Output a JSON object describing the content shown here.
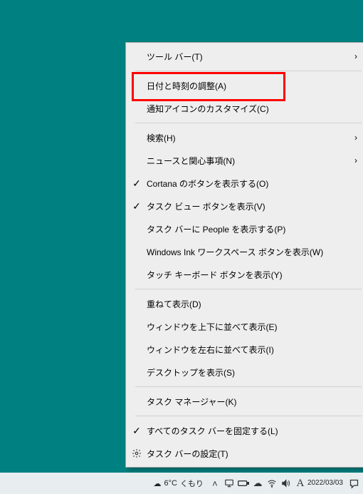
{
  "menu": {
    "groups": [
      [
        {
          "label": "ツール バー(T)",
          "checked": false,
          "submenu": true,
          "icon": null
        }
      ],
      [
        {
          "label": "日付と時刻の調整(A)",
          "checked": false,
          "submenu": false,
          "icon": null,
          "highlighted": true
        },
        {
          "label": "通知アイコンのカスタマイズ(C)",
          "checked": false,
          "submenu": false,
          "icon": null
        }
      ],
      [
        {
          "label": "検索(H)",
          "checked": false,
          "submenu": true,
          "icon": null
        },
        {
          "label": "ニュースと関心事項(N)",
          "checked": false,
          "submenu": true,
          "icon": null
        },
        {
          "label": "Cortana のボタンを表示する(O)",
          "checked": true,
          "submenu": false,
          "icon": null
        },
        {
          "label": "タスク ビュー ボタンを表示(V)",
          "checked": true,
          "submenu": false,
          "icon": null
        },
        {
          "label": "タスク バーに People を表示する(P)",
          "checked": false,
          "submenu": false,
          "icon": null
        },
        {
          "label": "Windows Ink ワークスペース ボタンを表示(W)",
          "checked": false,
          "submenu": false,
          "icon": null
        },
        {
          "label": "タッチ キーボード ボタンを表示(Y)",
          "checked": false,
          "submenu": false,
          "icon": null
        }
      ],
      [
        {
          "label": "重ねて表示(D)",
          "checked": false,
          "submenu": false,
          "icon": null
        },
        {
          "label": "ウィンドウを上下に並べて表示(E)",
          "checked": false,
          "submenu": false,
          "icon": null
        },
        {
          "label": "ウィンドウを左右に並べて表示(I)",
          "checked": false,
          "submenu": false,
          "icon": null
        },
        {
          "label": "デスクトップを表示(S)",
          "checked": false,
          "submenu": false,
          "icon": null
        }
      ],
      [
        {
          "label": "タスク マネージャー(K)",
          "checked": false,
          "submenu": false,
          "icon": null
        }
      ],
      [
        {
          "label": "すべてのタスク バーを固定する(L)",
          "checked": true,
          "submenu": false,
          "icon": null
        },
        {
          "label": "タスク バーの設定(T)",
          "checked": false,
          "submenu": false,
          "icon": "gear"
        }
      ]
    ]
  },
  "taskbar": {
    "weather": {
      "temp": "6°C",
      "text": "くもり"
    },
    "tray_icons": [
      "chevron-up",
      "monitor",
      "battery",
      "cloud",
      "wifi",
      "volume",
      "ime-a"
    ],
    "clock": {
      "time": "",
      "date": "2022/03/03"
    }
  },
  "highlight": {
    "color": "#ff0000"
  }
}
